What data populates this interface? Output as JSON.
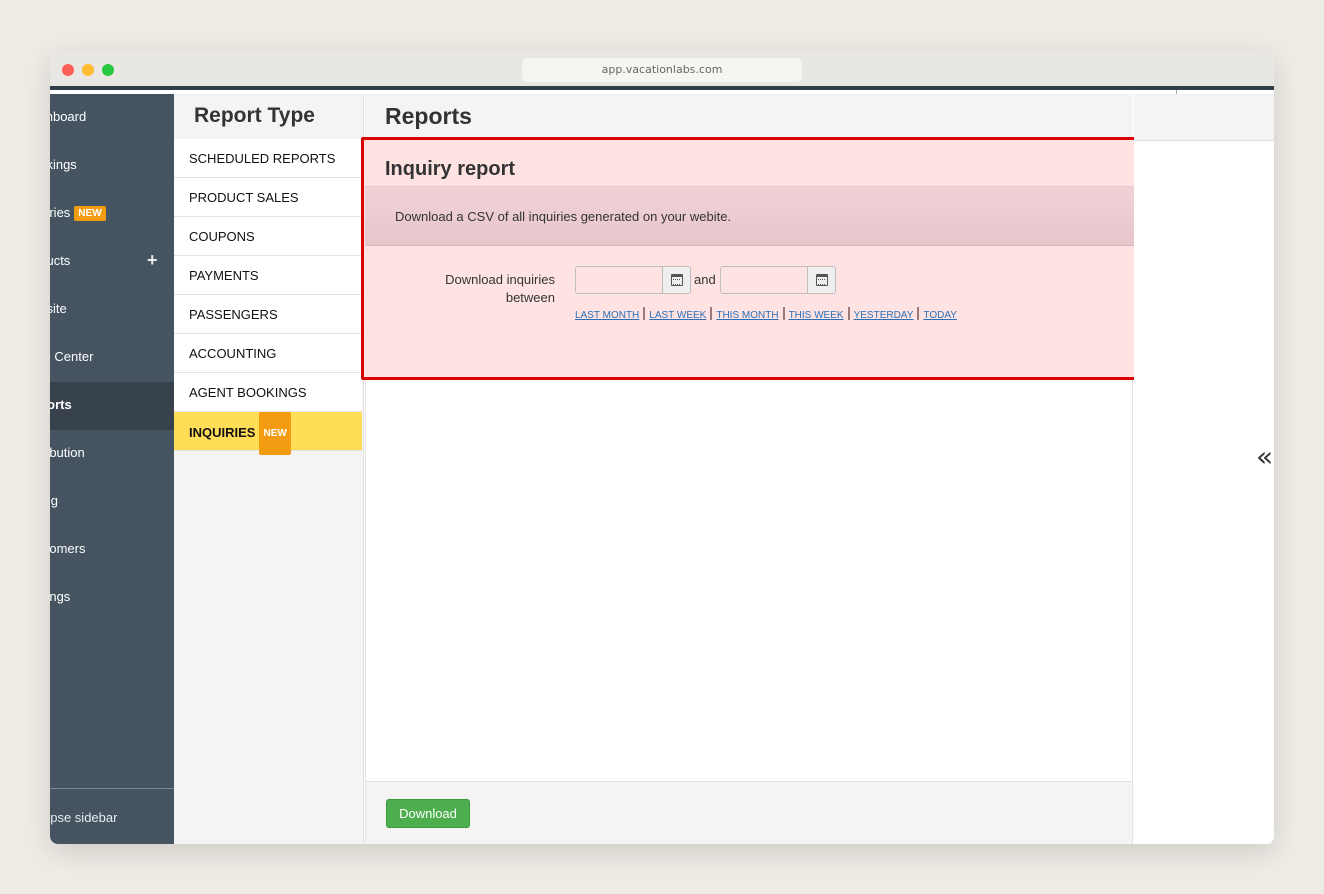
{
  "browser": {
    "url": "app.vacationlabs.com"
  },
  "sidebar": {
    "items": [
      {
        "label": "ashboard",
        "badge": ""
      },
      {
        "label": "ookings",
        "badge": ""
      },
      {
        "label": "quiries",
        "badge": "NEW"
      },
      {
        "label": "oducts",
        "badge": "",
        "action_icon": "+"
      },
      {
        "label": "ebsite",
        "badge": ""
      },
      {
        "label": "EO Center",
        "badge": ""
      },
      {
        "label": "eports",
        "badge": "",
        "active": true
      },
      {
        "label": "stribution",
        "badge": ""
      },
      {
        "label": "illing",
        "badge": ""
      },
      {
        "label": "ustomers",
        "badge": ""
      },
      {
        "label": "ettings",
        "badge": ""
      }
    ],
    "collapse_label": "ollapse sidebar"
  },
  "report_type": {
    "title": "Report Type",
    "items": [
      {
        "label": "SCHEDULED REPORTS"
      },
      {
        "label": "PRODUCT SALES"
      },
      {
        "label": "COUPONS"
      },
      {
        "label": "PAYMENTS"
      },
      {
        "label": "PASSENGERS"
      },
      {
        "label": "ACCOUNTING"
      },
      {
        "label": "AGENT BOOKINGS"
      },
      {
        "label": "INQUIRIES",
        "badge": "NEW",
        "active": true
      }
    ]
  },
  "main": {
    "title": "Reports",
    "panel": {
      "title": "Inquiry report",
      "description": "Download a CSV of all inquiries generated on your webite.",
      "form_label_line1": "Download inquiries",
      "form_label_line2": "between",
      "start_date": "",
      "end_date": "",
      "and_label": "and",
      "quick_ranges": [
        "LAST MONTH",
        "LAST WEEK",
        "THIS MONTH",
        "THIS WEEK",
        "YESTERDAY",
        "TODAY"
      ]
    },
    "download_label": "Download"
  },
  "right_pane": {
    "collapse_icon": "«"
  },
  "colors": {
    "sidebar": "#465461",
    "sidebar_active": "#37424c",
    "badge": "#f39c12",
    "active_report": "#ffdd57",
    "panel_bg": "#ffe3e3",
    "highlight_border": "#d80000",
    "download_button": "#4cae4c",
    "link": "#2a6fb8"
  }
}
